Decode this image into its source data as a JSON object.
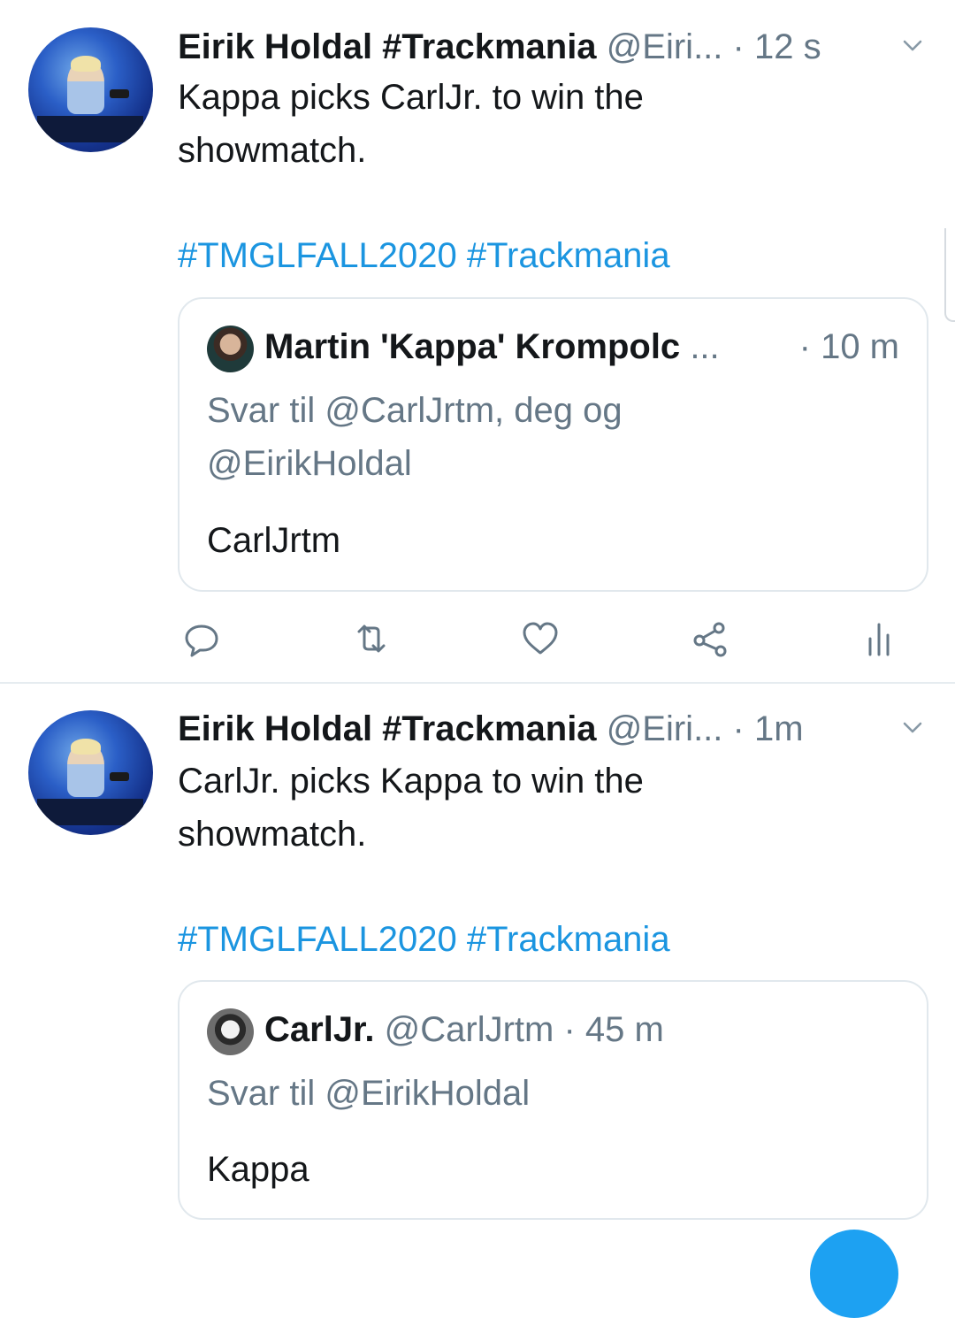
{
  "tweets": [
    {
      "author_name": "Eirik Holdal #Trackmania",
      "author_handle": "@Eiri...",
      "time": "· 12 s",
      "text": "Kappa picks CarlJr. to win the\nshowmatch.",
      "hashtags": "#TMGLFALL2020 #Trackmania",
      "quote": {
        "author": "Martin 'Kappa' Krompolc",
        "ellipsis": "...",
        "time": "· 10 m",
        "reply_to": "Svar til @CarlJrtm, deg og\n@EirikHoldal",
        "text": "CarlJrtm"
      }
    },
    {
      "author_name": "Eirik Holdal #Trackmania",
      "author_handle": "@Eiri...",
      "time": "· 1m",
      "text": "CarlJr. picks Kappa to win the\nshowmatch.",
      "hashtags": "#TMGLFALL2020 #Trackmania",
      "quote": {
        "author": "CarlJr.",
        "handle": "@CarlJrtm",
        "time": "· 45 m",
        "reply_to": "Svar til @EirikHoldal",
        "text": "Kappa"
      }
    }
  ],
  "icons": {
    "reply": "reply-icon",
    "retweet": "retweet-icon",
    "like": "heart-icon",
    "share": "share-icon",
    "analytics": "analytics-icon",
    "menu": "chevron-down-icon"
  },
  "colors": {
    "hashtag": "#1b95e0",
    "secondary_text": "#657786",
    "primary_text": "#14171a",
    "border": "#e1e8ed",
    "fab": "#1da1f2"
  }
}
